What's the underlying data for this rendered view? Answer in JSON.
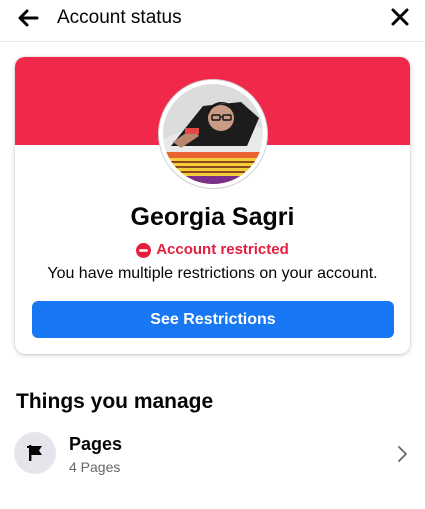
{
  "header": {
    "title": "Account status",
    "back_icon": "arrow-left-icon",
    "close_icon": "close-icon"
  },
  "account_card": {
    "name": "Georgia Sagri",
    "status_icon": "no-entry-icon",
    "status": "Account restricted",
    "description": "You have multiple restrictions on your account.",
    "button_label": "See Restrictions",
    "colors": {
      "banner": "#f02849",
      "status": "#e41e3f",
      "button": "#1877f2"
    }
  },
  "managed": {
    "section_title": "Things you manage",
    "items": [
      {
        "icon": "flag-icon",
        "title": "Pages",
        "subtitle": "4 Pages",
        "chevron_icon": "chevron-right-icon"
      }
    ]
  }
}
